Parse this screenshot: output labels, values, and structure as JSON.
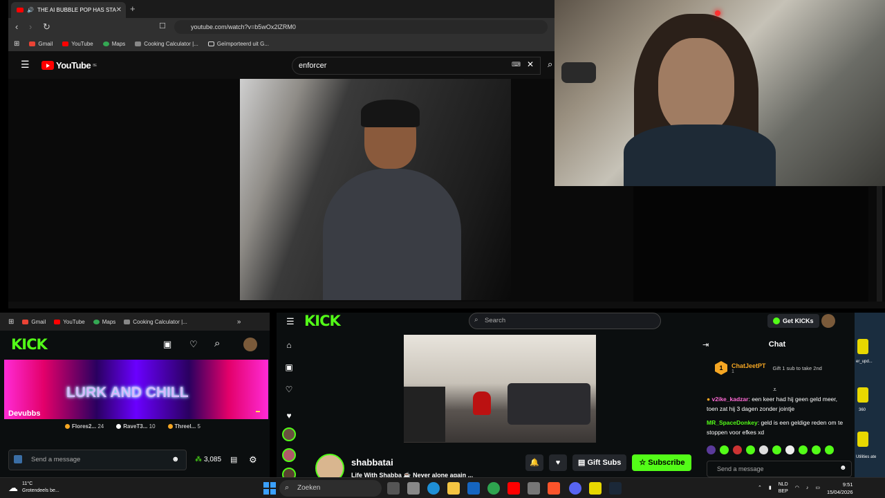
{
  "browser": {
    "tab_title": "THE AI BUBBLE POP HAS STA",
    "url": "youtube.com/watch?v=b5wOx2lZRM0",
    "bookmarks": [
      "Gmail",
      "YouTube",
      "Maps",
      "Cooking Calculator |...",
      "Geïmporteerd uit G..."
    ]
  },
  "youtube": {
    "logo": "YouTube",
    "region": "BE",
    "search_value": "enforcer"
  },
  "left_window": {
    "bookmarks": [
      "Gmail",
      "YouTube",
      "Maps",
      "Cooking Calculator |..."
    ],
    "logo": "KICK",
    "banner_text": "LURK AND CHILL",
    "banner_name": "Devubbs",
    "viewer_entries": [
      {
        "name": "Flores2...",
        "count": "24"
      },
      {
        "name": "RaveT3...",
        "count": "10"
      },
      {
        "name": "Threel...",
        "count": "5"
      }
    ],
    "message_placeholder": "Send a message",
    "points": "3,085"
  },
  "kick": {
    "logo": "KICK",
    "search_placeholder": "Search",
    "get_kicks": "Get KICKs",
    "channel_name": "shabbatai",
    "stream_title": "Life With Shabba ☕ Never alone again ...",
    "gift_subs": "Gift Subs",
    "subscribe": "Subscribe",
    "chat": {
      "title": "Chat",
      "pinned_user": "ChatJeetPT",
      "pinned_count": "1",
      "pinned_note": "Gift 1 sub to take 2nd",
      "messages": [
        {
          "user": "v2ike_kadzar",
          "text": "een keer had hij geen geld meer, toen zat hij 3 dagen zonder jointje"
        },
        {
          "user": "MR_SpaceDonkey",
          "text": "geld is een geldige reden om te stoppen voor efkes xd"
        }
      ],
      "input_placeholder": "Send a message"
    }
  },
  "desktop": {
    "labels": [
      "er_upd...",
      "360",
      "Utilities ate"
    ]
  },
  "taskbar": {
    "temperature": "11°C",
    "weather": "Grotendeels be...",
    "search_placeholder": "Zoeken",
    "lang": "NLD",
    "lang2": "BEP",
    "time": "9:51",
    "date": "15/04/2026"
  },
  "colors": {
    "kick_green": "#53fc18",
    "youtube_red": "#ff0000"
  }
}
